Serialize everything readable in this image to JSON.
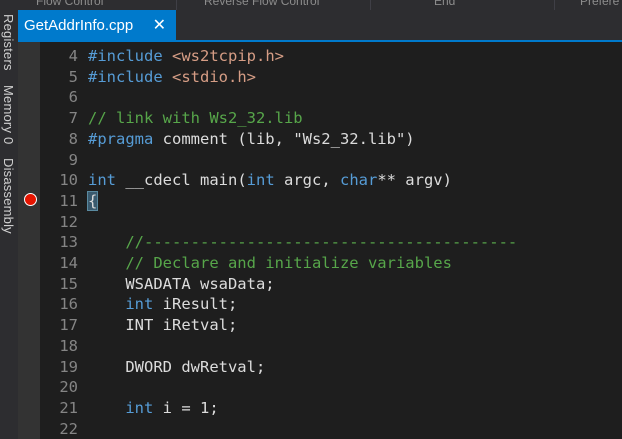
{
  "toolbar": {
    "items": [
      "Flow Control",
      "Reverse Flow Control",
      "End",
      "Prefere"
    ]
  },
  "tab": {
    "title": "GetAddrInfo.cpp",
    "close_glyph": "✕"
  },
  "side_panel": {
    "items": [
      "Registers",
      "Memory 0",
      "Disassembly"
    ]
  },
  "editor": {
    "lines": [
      {
        "num": "4",
        "parts": [
          {
            "t": "#include",
            "c": "kw"
          },
          {
            "t": " ",
            "c": ""
          },
          {
            "t": "<ws2tcpip.h>",
            "c": "str"
          }
        ]
      },
      {
        "num": "5",
        "parts": [
          {
            "t": "#include",
            "c": "kw"
          },
          {
            "t": " ",
            "c": ""
          },
          {
            "t": "<stdio.h>",
            "c": "str"
          }
        ]
      },
      {
        "num": "6",
        "parts": []
      },
      {
        "num": "7",
        "parts": [
          {
            "t": "// link with Ws2_32.lib",
            "c": "com"
          }
        ]
      },
      {
        "num": "8",
        "parts": [
          {
            "t": "#pragma",
            "c": "kw"
          },
          {
            "t": " comment (lib, ",
            "c": ""
          },
          {
            "t": "\"Ws2_32.lib\"",
            "c": ""
          },
          {
            "t": ")",
            "c": ""
          }
        ]
      },
      {
        "num": "9",
        "parts": []
      },
      {
        "num": "10",
        "parts": [
          {
            "t": "int",
            "c": "kw"
          },
          {
            "t": " __cdecl main(",
            "c": ""
          },
          {
            "t": "int",
            "c": "kw"
          },
          {
            "t": " argc, ",
            "c": ""
          },
          {
            "t": "char",
            "c": "kw"
          },
          {
            "t": "** argv)",
            "c": ""
          }
        ]
      },
      {
        "num": "11",
        "parts": [
          {
            "t": "{",
            "c": "brace-hl"
          }
        ]
      },
      {
        "num": "12",
        "parts": []
      },
      {
        "num": "13",
        "parts": [
          {
            "t": "    //----------------------------------------",
            "c": "com"
          }
        ]
      },
      {
        "num": "14",
        "parts": [
          {
            "t": "    // Declare and initialize variables",
            "c": "com"
          }
        ]
      },
      {
        "num": "15",
        "parts": [
          {
            "t": "    WSADATA wsaData;",
            "c": ""
          }
        ]
      },
      {
        "num": "16",
        "parts": [
          {
            "t": "    ",
            "c": ""
          },
          {
            "t": "int",
            "c": "kw"
          },
          {
            "t": " iResult;",
            "c": ""
          }
        ]
      },
      {
        "num": "17",
        "parts": [
          {
            "t": "    INT iRetval;",
            "c": ""
          }
        ]
      },
      {
        "num": "18",
        "parts": []
      },
      {
        "num": "19",
        "parts": [
          {
            "t": "    DWORD dwRetval;",
            "c": ""
          }
        ]
      },
      {
        "num": "20",
        "parts": []
      },
      {
        "num": "21",
        "parts": [
          {
            "t": "    ",
            "c": ""
          },
          {
            "t": "int",
            "c": "kw"
          },
          {
            "t": " i = 1;",
            "c": ""
          }
        ]
      },
      {
        "num": "22",
        "parts": []
      }
    ]
  },
  "colors": {
    "accent": "#007acc",
    "breakpoint": "#e51400",
    "keyword": "#569cd6",
    "comment": "#57a64a",
    "string": "#d69d85"
  }
}
